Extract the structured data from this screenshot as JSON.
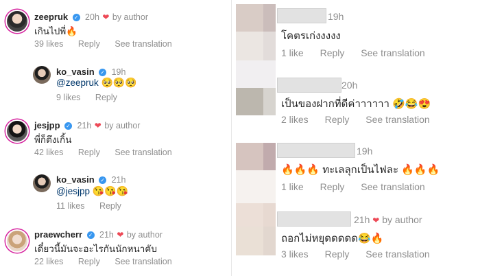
{
  "left": {
    "comments": [
      {
        "username": "zeepruk",
        "time": "20h",
        "by_author": "by author",
        "text": "เกินไปพี่🔥",
        "likes": "39 likes",
        "reply": "Reply",
        "see_translation": "See translation"
      },
      {
        "username": "ko_vasin",
        "time": "19h",
        "mention": "@zeepruk",
        "emoji": "🥺🥺🥺",
        "likes": "9 likes",
        "reply": "Reply"
      },
      {
        "username": "jesjpp",
        "time": "21h",
        "by_author": "by author",
        "text": "พี่ก็ตึงเกิ้น",
        "likes": "42 likes",
        "reply": "Reply",
        "see_translation": "See translation"
      },
      {
        "username": "ko_vasin",
        "time": "21h",
        "mention": "@jesjpp",
        "emoji": "😘😘😘",
        "likes": "11 likes",
        "reply": "Reply"
      },
      {
        "username": "praewcherr",
        "time": "21h",
        "by_author": "by author",
        "text": "เดี๋ยวนี้มันจะอะไรกันนักหนาคับ",
        "likes": "22 likes",
        "reply": "Reply",
        "see_translation": "See translation"
      }
    ]
  },
  "right": {
    "comments": [
      {
        "time": "19h",
        "text": "โคตรเก่งงงงง",
        "likes": "1 like",
        "reply": "Reply",
        "see_translation": "See translation"
      },
      {
        "time": "20h",
        "text": "เป็นของฝากที่ดีค่าาาาาา 🤣😂😍",
        "likes": "2 likes",
        "reply": "Reply",
        "see_translation": "See translation"
      },
      {
        "time": "19h",
        "text": "🔥🔥🔥 ทะเลลุกเป็นไฟละ 🔥🔥🔥",
        "likes": "1 like",
        "reply": "Reply",
        "see_translation": "See translation"
      },
      {
        "time": "21h",
        "by_author": "by author",
        "text": "ถอกไม่หยุดดดดด😂🔥",
        "likes": "3 likes",
        "reply": "Reply",
        "see_translation": "See translation"
      }
    ]
  },
  "icons": {
    "heart_outline": "heart-outline-icon",
    "verified": "verified-badge-icon",
    "heart_filled": "heart-filled-icon"
  },
  "colors": {
    "verified": "#3897f0",
    "heart": "#ed4956",
    "muted": "#8e8e8e",
    "mention": "#00376b"
  }
}
